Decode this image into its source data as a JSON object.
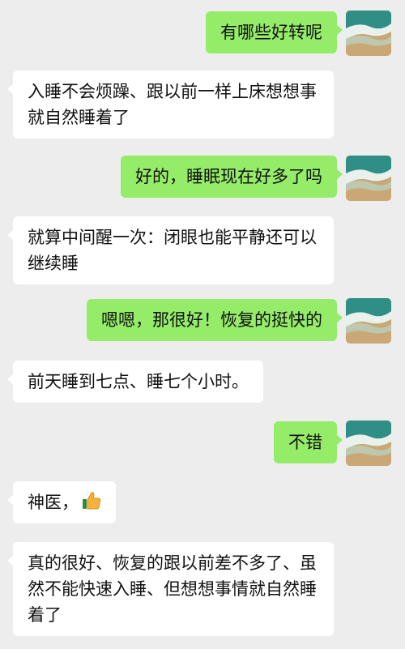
{
  "messages": [
    {
      "side": "out",
      "text": "有哪些好转呢"
    },
    {
      "side": "in",
      "text": "入睡不会烦躁、跟以前一样上床想想事就自然睡着了"
    },
    {
      "side": "out",
      "text": "好的，睡眠现在好多了吗"
    },
    {
      "side": "in",
      "text": "就算中间醒一次：闭眼也能平静还可以继续睡"
    },
    {
      "side": "out",
      "text": "嗯嗯，那很好！恢复的挺快的"
    },
    {
      "side": "in",
      "text": "前天睡到七点、睡七个小时。"
    },
    {
      "side": "out",
      "text": "不错"
    },
    {
      "side": "in",
      "text": "神医，",
      "emoji": "thumbs-up-icon"
    },
    {
      "side": "in",
      "text": "真的很好、恢复的跟以前差不多了、虽然不能快速入睡、但想想事情就自然睡着了"
    }
  ],
  "avatar": {
    "icon": "beach-avatar-icon"
  },
  "colors": {
    "background": "#EDEDED",
    "outgoing_bubble": "#95EC69",
    "incoming_bubble": "#FFFFFF",
    "text": "#111111"
  }
}
